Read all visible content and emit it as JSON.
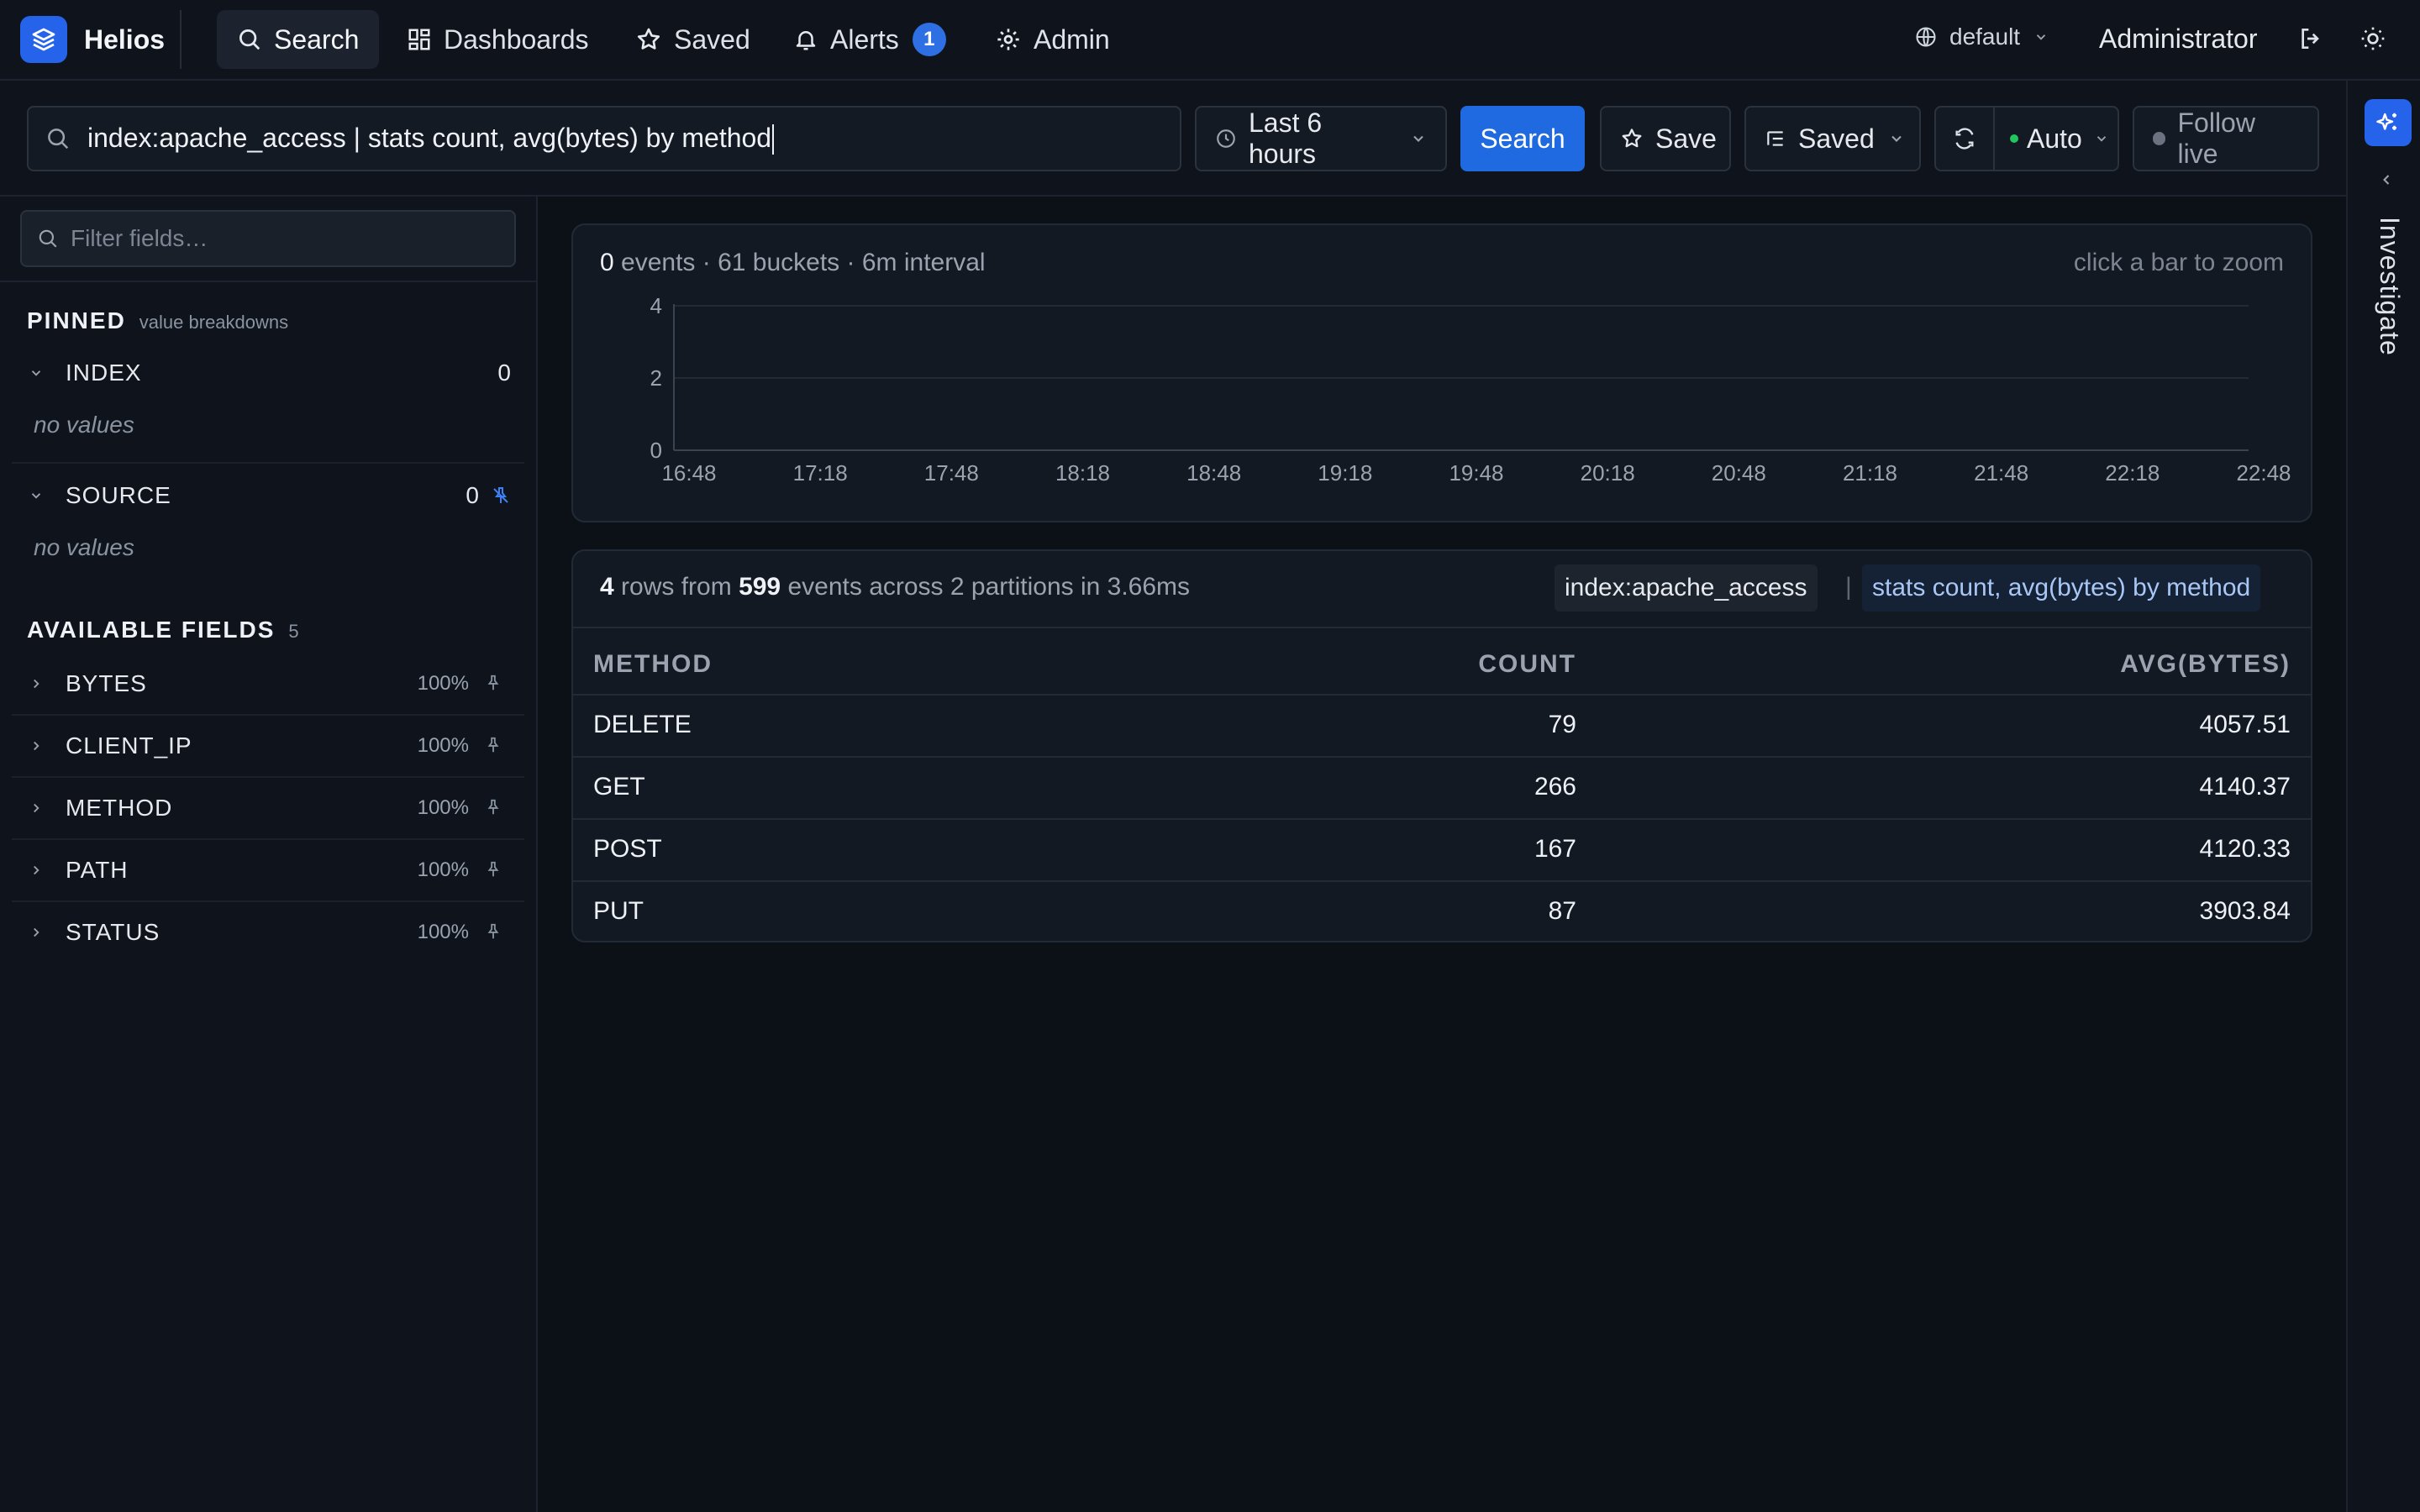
{
  "app": {
    "name": "Helios"
  },
  "nav": {
    "items": [
      {
        "label": "Search",
        "icon": "search-icon"
      },
      {
        "label": "Dashboards",
        "icon": "dashboard-icon"
      },
      {
        "label": "Saved",
        "icon": "star-icon"
      },
      {
        "label": "Alerts",
        "icon": "bell-icon",
        "badge": "1"
      },
      {
        "label": "Admin",
        "icon": "gear-icon"
      }
    ],
    "active": "Search",
    "tenant": "default",
    "user": "Administrator"
  },
  "toolbar": {
    "query": "index:apache_access | stats count, avg(bytes) by method",
    "time_range": "Last 6 hours",
    "search_label": "Search",
    "save_label": "Save",
    "saved_label": "Saved",
    "refresh_mode": "Auto",
    "follow_label": "Follow live"
  },
  "sidebar": {
    "filter_placeholder": "Filter fields…",
    "pinned_title": "PINNED",
    "pinned_subtitle": "value breakdowns",
    "pinned": [
      {
        "name": "INDEX",
        "count": "0",
        "empty": "no values"
      },
      {
        "name": "SOURCE",
        "count": "0",
        "empty": "no values"
      }
    ],
    "available_title": "AVAILABLE FIELDS",
    "available_count": "5",
    "available": [
      {
        "name": "BYTES",
        "coverage": "100%"
      },
      {
        "name": "CLIENT_IP",
        "coverage": "100%"
      },
      {
        "name": "METHOD",
        "coverage": "100%"
      },
      {
        "name": "PATH",
        "coverage": "100%"
      },
      {
        "name": "STATUS",
        "coverage": "100%"
      }
    ]
  },
  "histogram": {
    "events": "0",
    "summary": "events · 61 buckets · 6m interval",
    "hint": "click a bar to zoom"
  },
  "chart_data": {
    "type": "bar",
    "title": "",
    "xlabel": "",
    "ylabel": "",
    "categories": [
      "16:48",
      "17:18",
      "17:48",
      "18:18",
      "18:48",
      "19:18",
      "19:48",
      "20:18",
      "20:48",
      "21:18",
      "21:48",
      "22:18",
      "22:48"
    ],
    "values": [
      0,
      0,
      0,
      0,
      0,
      0,
      0,
      0,
      0,
      0,
      0,
      0,
      0
    ],
    "y_ticks": [
      "0",
      "2",
      "4"
    ],
    "ylim": [
      0,
      4
    ],
    "grid": true
  },
  "results": {
    "rows": "4",
    "rows_label": "rows from",
    "events": "599",
    "events_label": "events across 2 partitions in 3.66ms",
    "query_index": "index:apache_access",
    "query_separator": "|",
    "query_command": "stats count, avg(bytes) by method",
    "columns": [
      "METHOD",
      "COUNT",
      "AVG(BYTES)"
    ],
    "data": [
      [
        "DELETE",
        "79",
        "4057.51"
      ],
      [
        "GET",
        "266",
        "4140.37"
      ],
      [
        "POST",
        "167",
        "4120.33"
      ],
      [
        "PUT",
        "87",
        "3903.84"
      ]
    ]
  },
  "rail": {
    "label": "Investigate"
  },
  "colors": {
    "accent": "#2563eb",
    "background": "#0c1017",
    "panel": "#131922",
    "live": "#22c55e"
  }
}
